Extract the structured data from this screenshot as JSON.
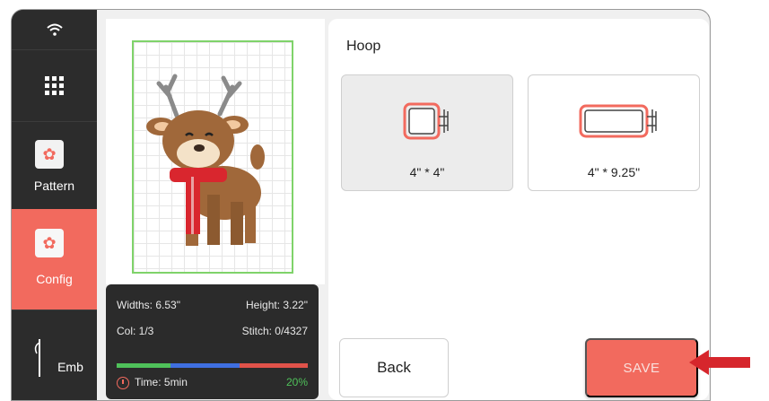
{
  "sidebar": {
    "items": [
      {
        "label": "",
        "icon": "wifi-icon"
      },
      {
        "label": "",
        "icon": "menu-grid-icon"
      },
      {
        "label": "Pattern",
        "icon": "pattern-icon"
      },
      {
        "label": "Config",
        "icon": "config-icon",
        "active": true
      },
      {
        "label": "Emb",
        "icon": "needle-icon"
      }
    ]
  },
  "preview": {
    "widths": "Widths: 6.53\"",
    "height": "Height: 3.22\"",
    "col": "Col: 1/3",
    "stitch": "Stitch: 0/4327",
    "time": "Time: 5min",
    "percent": "20%",
    "progress_colors": [
      "#4fc15a",
      "#3f6fe0",
      "#e0524a"
    ],
    "progress_fraction": 0.2
  },
  "hoop": {
    "title": "Hoop",
    "options": [
      {
        "label": "4\" * 4\"",
        "selected": true
      },
      {
        "label": "4\" * 9.25\"",
        "selected": false
      }
    ]
  },
  "buttons": {
    "back": "Back",
    "save": "SAVE"
  },
  "colors": {
    "accent": "#f26a5e",
    "sidebar_bg": "#2c2c2c",
    "hoop_frame_green": "#7fd36a"
  }
}
